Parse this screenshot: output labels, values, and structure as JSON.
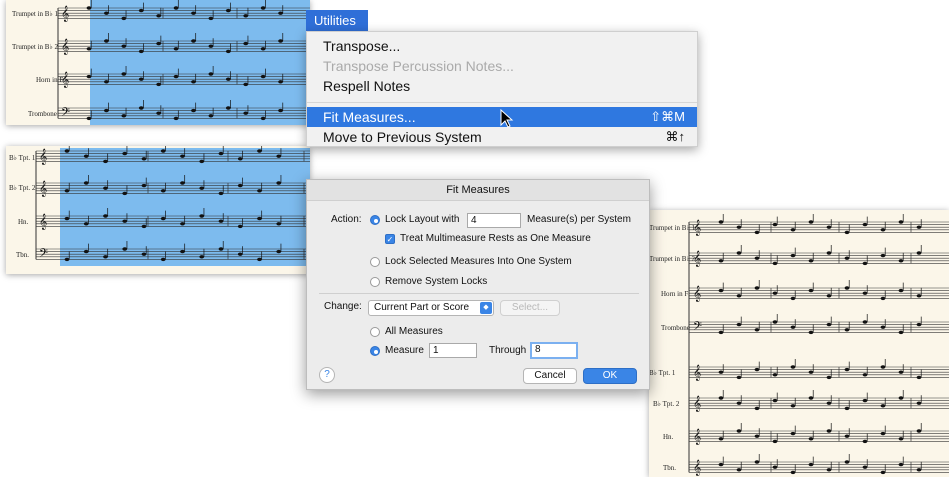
{
  "menu": {
    "title": "Utilities",
    "items": [
      {
        "label": "Transpose...",
        "enabled": true,
        "highlighted": false,
        "shortcut": ""
      },
      {
        "label": "Transpose Percussion Notes...",
        "enabled": false,
        "highlighted": false,
        "shortcut": ""
      },
      {
        "label": "Respell Notes",
        "enabled": true,
        "highlighted": false,
        "shortcut": ""
      },
      {
        "label": "Fit Measures...",
        "enabled": true,
        "highlighted": true,
        "shortcut": "⇧⌘M"
      },
      {
        "label": "Move to Previous System",
        "enabled": true,
        "highlighted": false,
        "shortcut": "⌘↑"
      }
    ]
  },
  "dialog": {
    "title": "Fit Measures",
    "action_label": "Action:",
    "lock_layout_label": "Lock Layout with",
    "lock_layout_value": "4",
    "measures_per_system_label": "Measure(s) per System",
    "treat_multimeasure_label": "Treat Multimeasure Rests as One Measure",
    "lock_selected_label": "Lock Selected Measures Into One System",
    "remove_locks_label": "Remove System Locks",
    "change_label": "Change:",
    "change_value": "Current Part or Score",
    "select_button": "Select...",
    "all_measures_label": "All Measures",
    "measure_label": "Measure",
    "measure_from": "1",
    "through_label": "Through",
    "measure_to": "8",
    "cancel_button": "Cancel",
    "ok_button": "OK",
    "help_glyph": "?"
  },
  "score_left": {
    "system1_instruments": [
      "Trumpet in B♭ 1",
      "Trumpet in B♭ 2",
      "Horn in F",
      "Trombone"
    ],
    "system2_instruments": [
      "B♭ Tpt. 1",
      "B♭ Tpt. 2",
      "Hn.",
      "Tbn."
    ]
  },
  "score_right": {
    "system1_instruments": [
      "Trumpet in B♭ 1",
      "Trumpet in B♭ 2",
      "Horn in F",
      "Trombone"
    ],
    "system2_instruments": [
      "B♭ Tpt. 1",
      "B♭ Tpt. 2",
      "Hn.",
      "Tbn."
    ]
  },
  "colors": {
    "selection": "#5aaaf0",
    "menu_highlight": "#2f78e0",
    "page": "#fbf6e9"
  }
}
